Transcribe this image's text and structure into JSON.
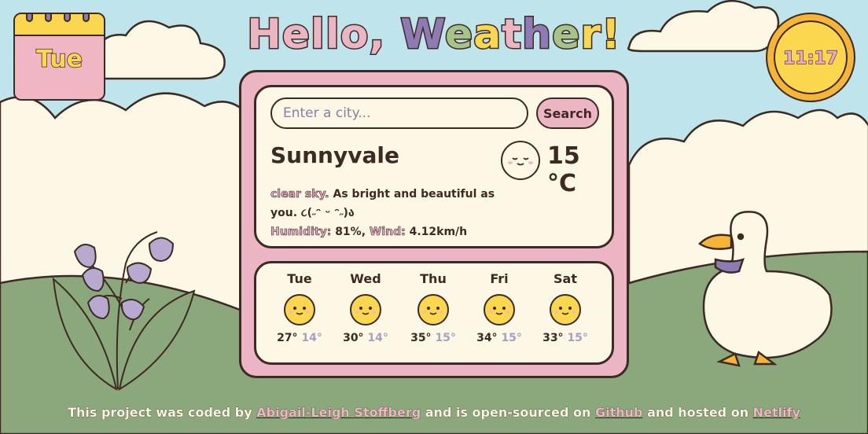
{
  "header": {
    "title_parts": [
      "Hello, ",
      "W",
      "e",
      "a",
      "t",
      "h",
      "e",
      "r",
      "!"
    ],
    "title_colors": [
      "#ecb5c4",
      "#8f7bb3",
      "#a6c38a",
      "#fbd64f",
      "#ecb5c4",
      "#8f7bb3",
      "#a6c38a",
      "#fbd64f",
      "#fbd64f"
    ]
  },
  "calendar": {
    "day": "Tue",
    "icon": "calendar-icon"
  },
  "clock": {
    "time": "11:17",
    "icon": "clock-icon"
  },
  "search": {
    "placeholder": "Enter a city...",
    "value": "",
    "button_label": "Search"
  },
  "current": {
    "city": "Sunnyvale",
    "temp_value": "15",
    "temp_unit": "°C",
    "icon": "sun-face-icon",
    "description_label": "clear sky.",
    "description_text": "As bright and beautiful as you. ૮(˶ᵔ ᵕ ᵔ˶)ა",
    "humidity_label": "Humidity:",
    "humidity_value": "81%",
    "separator": ",",
    "wind_label": "Wind:",
    "wind_value": "4.12km/h"
  },
  "forecast": [
    {
      "day": "Tue",
      "high": "27°",
      "low": "14°",
      "icon": "sun-face-icon"
    },
    {
      "day": "Wed",
      "high": "30°",
      "low": "14°",
      "icon": "sun-face-icon"
    },
    {
      "day": "Thu",
      "high": "35°",
      "low": "15°",
      "icon": "sun-face-icon"
    },
    {
      "day": "Fri",
      "high": "34°",
      "low": "15°",
      "icon": "sun-face-icon"
    },
    {
      "day": "Sat",
      "high": "33°",
      "low": "15°",
      "icon": "sun-face-icon"
    }
  ],
  "footer": {
    "text_1": "This project was coded by",
    "author_link": "Abigail-Leigh Stoffberg",
    "text_2": "and is open-sourced on",
    "github_link": "Github",
    "text_3": "and hosted on",
    "netlify_link": "Netlify"
  },
  "colors": {
    "sky": "#bfe4ec",
    "grass": "#8ba87c",
    "cream": "#fdf7e6",
    "pink": "#ecb5c4",
    "yellow": "#fbd64f",
    "lavender": "#8f7bb3",
    "outline": "#3d2a22"
  }
}
